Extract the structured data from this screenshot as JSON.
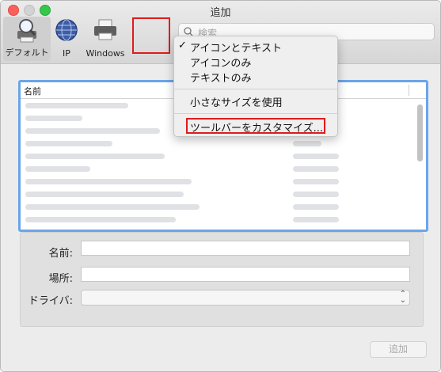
{
  "window": {
    "title": "追加"
  },
  "toolbar": {
    "items": [
      {
        "label": "デフォルト",
        "icon": "magnifier-printer-icon",
        "selected": true
      },
      {
        "label": "IP",
        "icon": "globe-icon",
        "selected": false
      },
      {
        "label": "Windows",
        "icon": "printer-icon",
        "selected": false
      }
    ],
    "search_placeholder": "検索"
  },
  "menu": {
    "items": [
      {
        "label": "アイコンとテキスト",
        "checked": true
      },
      {
        "label": "アイコンのみ",
        "checked": false
      },
      {
        "label": "テキストのみ",
        "checked": false
      },
      {
        "label": "小さなサイズを使用",
        "checked": false
      },
      {
        "label": "ツールバーをカスタマイズ...",
        "checked": false
      }
    ],
    "check_glyph": "✓"
  },
  "list": {
    "column_name": "名前"
  },
  "form": {
    "name_label": "名前:",
    "location_label": "場所:",
    "driver_label": "ドライバ:",
    "name_value": "",
    "location_value": "",
    "driver_value": ""
  },
  "footer": {
    "add_label": "追加"
  },
  "colors": {
    "highlight_red": "#e01b1b",
    "list_focus_ring": "#6aa5e9"
  }
}
